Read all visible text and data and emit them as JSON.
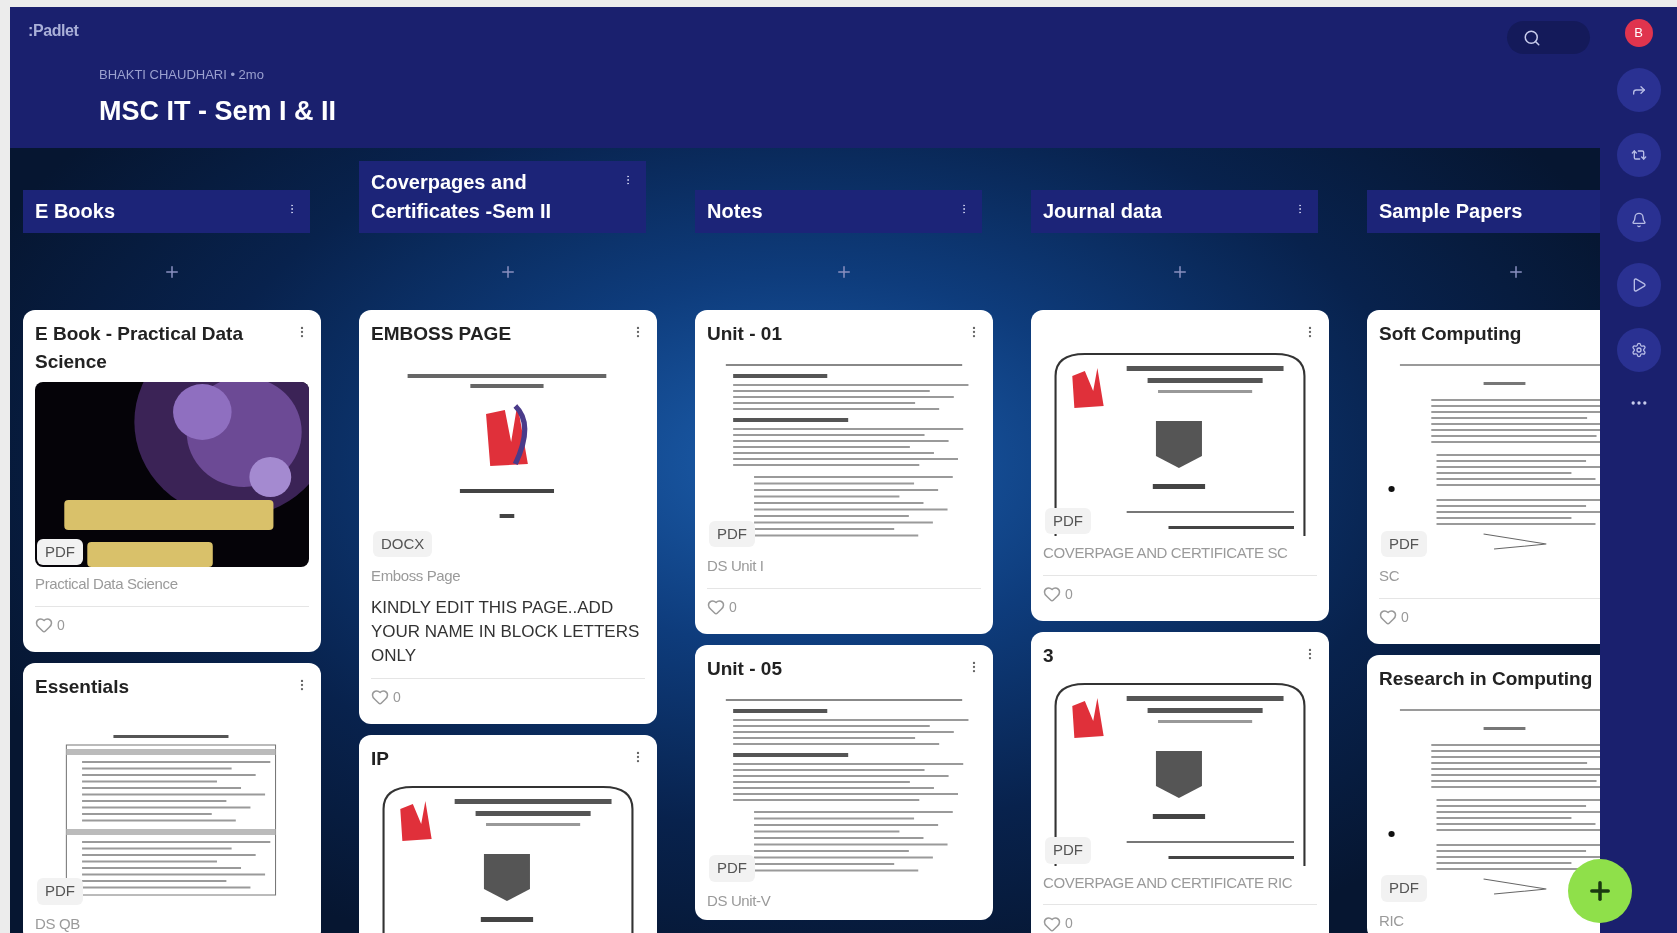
{
  "app": {
    "logo": ":Padlet"
  },
  "header": {
    "byline": "BHAKTI CHAUDHARI • 2mo",
    "title": "MSC IT - Sem I & II"
  },
  "rail": {
    "avatar": "B"
  },
  "columns": [
    {
      "title": "E Books",
      "posts": [
        {
          "title": "E Book - Practical Data Science",
          "preview": {
            "kind": "cover"
          },
          "attachment": "PDF",
          "caption": "Practical Data Science",
          "likes": "0"
        },
        {
          "title": "Essentials",
          "preview": {
            "kind": "table"
          },
          "attachment": "PDF",
          "caption": "DS QB"
        }
      ]
    },
    {
      "title": "Coverpages and Certificates -Sem II",
      "posts": [
        {
          "title": "EMBOSS PAGE",
          "preview": {
            "kind": "journal"
          },
          "attachment": "DOCX",
          "caption": "Emboss Page",
          "body": "KINDLY EDIT THIS PAGE..ADD YOUR NAME IN BLOCK LETTERS ONLY",
          "likes": "0"
        },
        {
          "title": "IP",
          "preview": {
            "kind": "certificate"
          }
        }
      ]
    },
    {
      "title": "Notes",
      "posts": [
        {
          "title": "Unit - 01",
          "preview": {
            "kind": "document"
          },
          "attachment": "PDF",
          "caption": "DS Unit I",
          "likes": "0"
        },
        {
          "title": "Unit - 05",
          "preview": {
            "kind": "document"
          },
          "attachment": "PDF",
          "caption": "DS Unit-V"
        }
      ]
    },
    {
      "title": "Journal data",
      "posts": [
        {
          "preview": {
            "kind": "certificate"
          },
          "attachment": "PDF",
          "caption": "COVERPAGE AND CERTIFICATE SC",
          "likes": "0"
        },
        {
          "title": "3",
          "preview": {
            "kind": "certificate"
          },
          "attachment": "PDF",
          "caption": "COVERPAGE AND CERTIFICATE RIC",
          "likes": "0"
        }
      ]
    },
    {
      "title": "Sample Papers",
      "posts": [
        {
          "title": "Soft Computing",
          "preview": {
            "kind": "paper"
          },
          "attachment": "PDF",
          "caption": "SC",
          "likes": "0"
        },
        {
          "title": "Research in Computing",
          "preview": {
            "kind": "paper"
          },
          "attachment": "PDF",
          "caption": "RIC"
        }
      ]
    }
  ]
}
